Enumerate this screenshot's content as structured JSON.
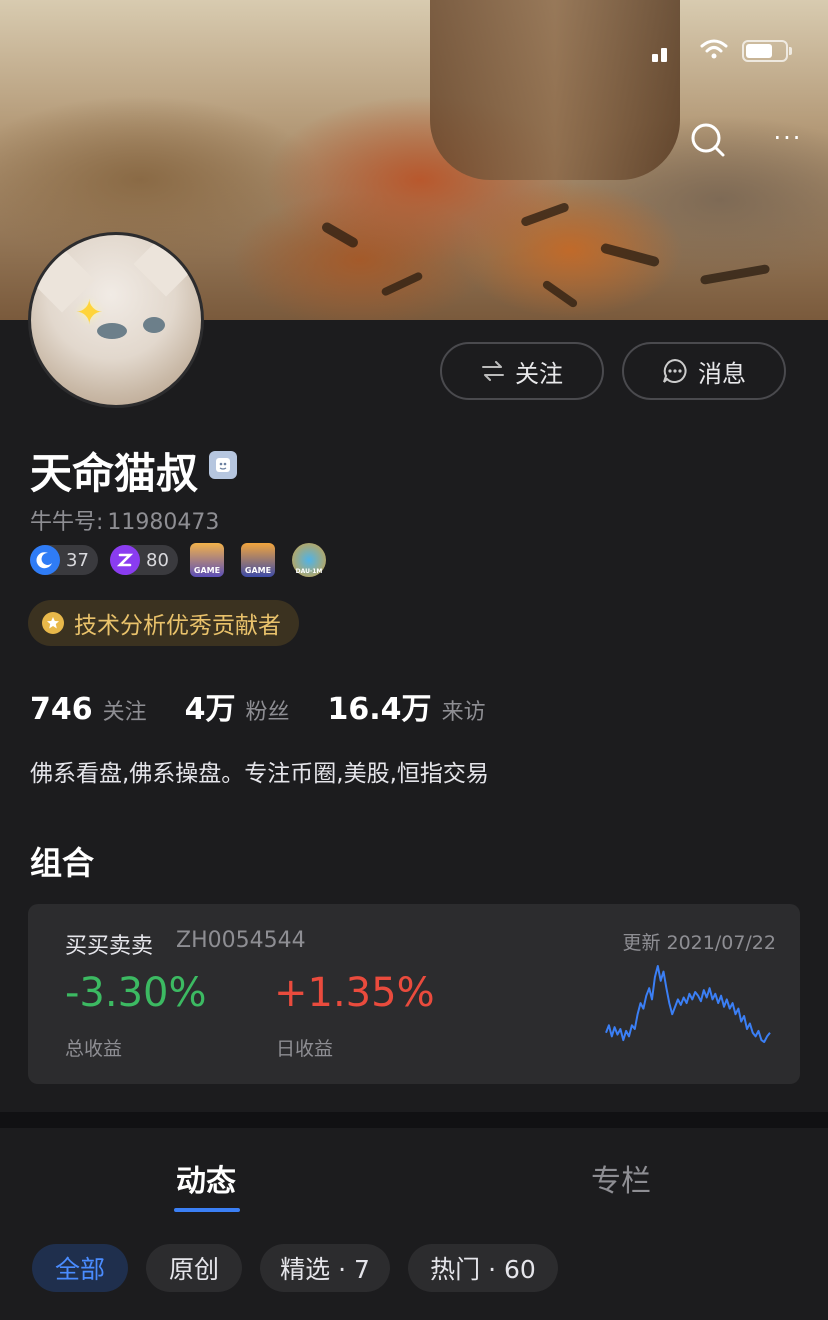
{
  "profile": {
    "name": "天命猫叔",
    "uid_label": "牛牛号:",
    "uid_value": "11980473",
    "bio": "佛系看盘,佛系操盘。专注币圈,美股,恒指交易",
    "honor": "技术分析优秀贡献者"
  },
  "actions": {
    "follow_label": "关注",
    "message_label": "消息"
  },
  "levels": [
    {
      "value": "37",
      "icon": "moon-level-icon",
      "color": "#2f7cf6"
    },
    {
      "value": "80",
      "icon": "z-level-icon",
      "color": "#8a3cf0"
    }
  ],
  "badges": [
    {
      "text": "GAME",
      "icon": "game-badge-icon-1"
    },
    {
      "text": "GAME",
      "icon": "game-badge-icon-2"
    },
    {
      "text": "DAU·1M",
      "icon": "globe-badge-icon"
    }
  ],
  "stats": [
    {
      "value": "746",
      "label": "关注"
    },
    {
      "value": "4万",
      "label": "粉丝"
    },
    {
      "value": "16.4万",
      "label": "来访"
    }
  ],
  "portfolio": {
    "section_title": "组合",
    "name": "买买卖卖",
    "code": "ZH0054544",
    "updated": "更新 2021/07/22",
    "total_return": "-3.30%",
    "total_return_label": "总收益",
    "day_return": "+1.35%",
    "day_return_label": "日收益",
    "sparkline": [
      42,
      46,
      40,
      45,
      41,
      44,
      38,
      43,
      40,
      46,
      44,
      52,
      58,
      55,
      62,
      66,
      60,
      72,
      78,
      70,
      75,
      66,
      58,
      52,
      56,
      60,
      57,
      61,
      58,
      63,
      60,
      64,
      62,
      59,
      65,
      61,
      66,
      60,
      63,
      58,
      62,
      56,
      60,
      55,
      58,
      52,
      55,
      48,
      51,
      44,
      47,
      42,
      40,
      43,
      38,
      37,
      40,
      42
    ]
  },
  "tabs": [
    {
      "label": "动态",
      "active": true
    },
    {
      "label": "专栏",
      "active": false
    }
  ],
  "filters": [
    {
      "label": "全部",
      "active": true
    },
    {
      "label": "原创",
      "active": false
    },
    {
      "label": "精选 · 7",
      "active": false
    },
    {
      "label": "热门 · 60",
      "active": false
    }
  ],
  "colors": {
    "background": "#1c1c1e",
    "accent": "#3b7ff5",
    "gain": "#ea4b3d",
    "loss": "#3cba62",
    "honor": "#e9c26b"
  }
}
